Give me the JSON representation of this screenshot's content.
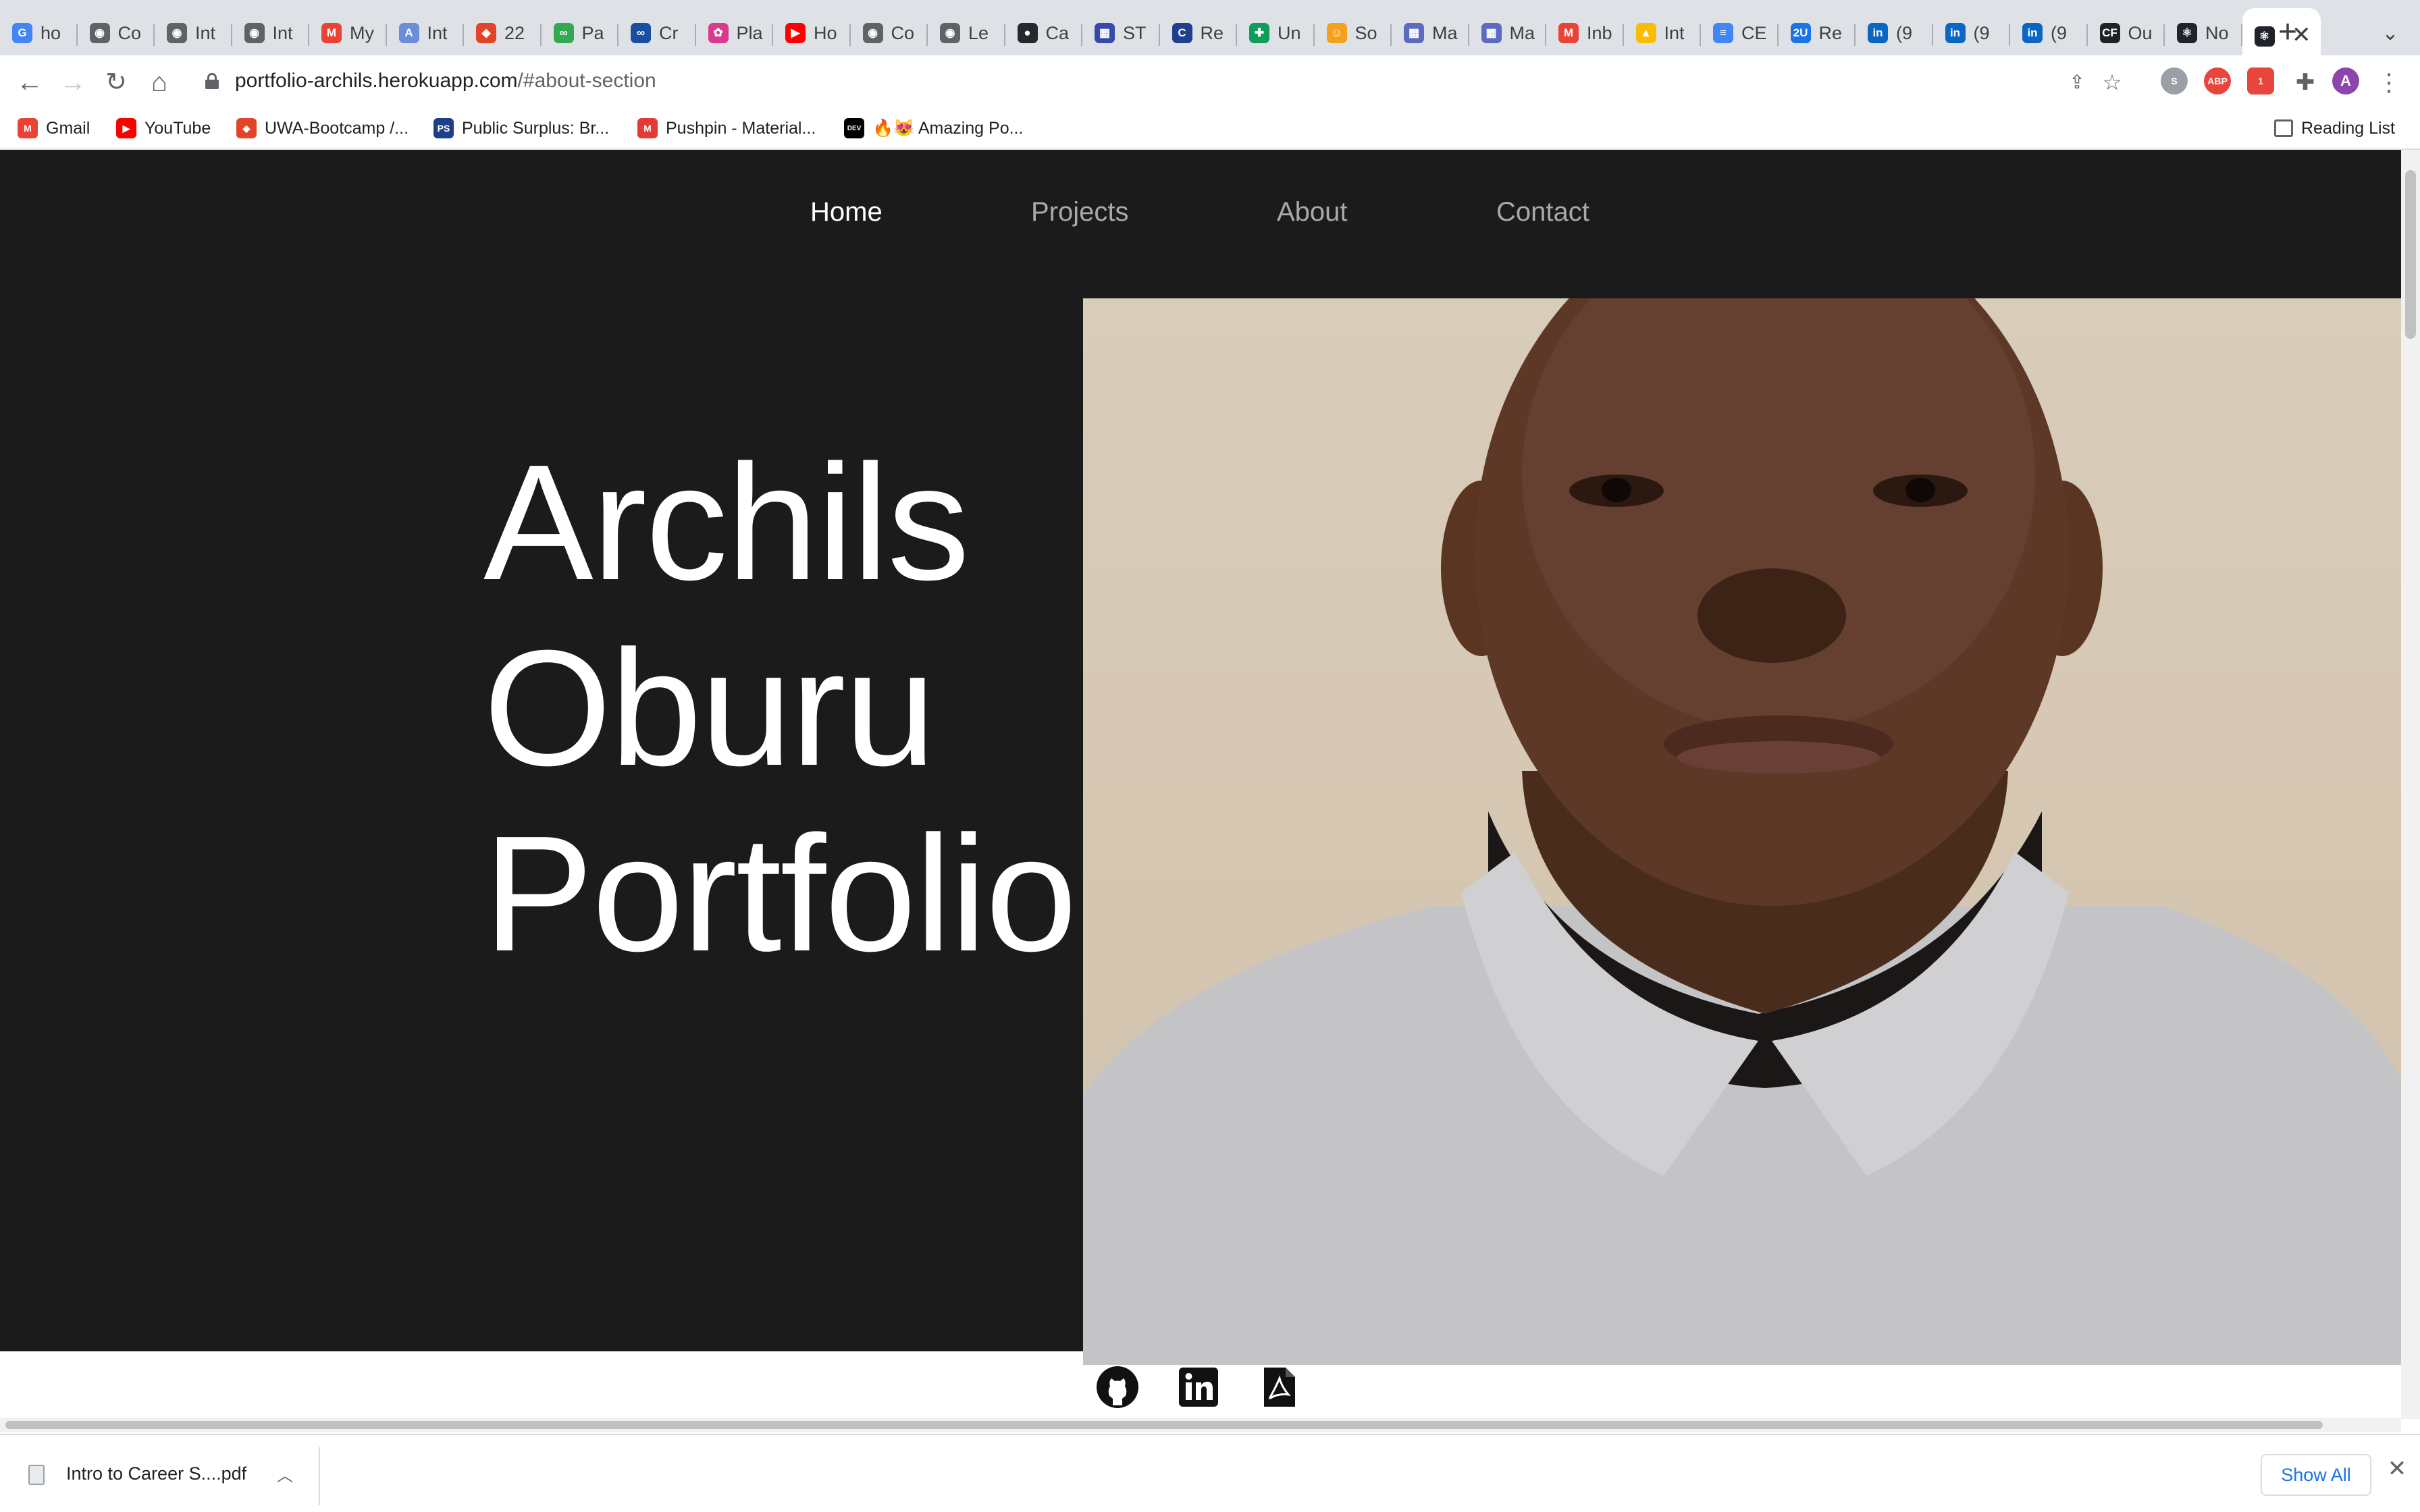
{
  "browser": {
    "tabs": [
      {
        "icon": "google-icon",
        "title": "ho",
        "color": "#4285f4",
        "glyph": "G"
      },
      {
        "icon": "globe-icon",
        "title": "Co",
        "color": "#5f6368",
        "glyph": "◉"
      },
      {
        "icon": "globe-icon",
        "title": "Int",
        "color": "#5f6368",
        "glyph": "◉"
      },
      {
        "icon": "globe-icon",
        "title": "Int",
        "color": "#5f6368",
        "glyph": "◉"
      },
      {
        "icon": "gmail-icon",
        "title": "My",
        "color": "#ea4335",
        "glyph": "M"
      },
      {
        "icon": "font-icon",
        "title": "Int",
        "color": "#6a8fd8",
        "glyph": "A"
      },
      {
        "icon": "gitlab-icon",
        "title": "22",
        "color": "#e24329",
        "glyph": "◆"
      },
      {
        "icon": "link-icon",
        "title": "Pa",
        "color": "#34a853",
        "glyph": "∞"
      },
      {
        "icon": "codepen-icon",
        "title": "Cr",
        "color": "#1a4fa0",
        "glyph": "∞"
      },
      {
        "icon": "flower-icon",
        "title": "Pla",
        "color": "#d93a8e",
        "glyph": "✿"
      },
      {
        "icon": "youtube-icon",
        "title": "Ho",
        "color": "#ff0000",
        "glyph": "▶"
      },
      {
        "icon": "globe-icon",
        "title": "Co",
        "color": "#5f6368",
        "glyph": "◉"
      },
      {
        "icon": "globe-icon",
        "title": "Le",
        "color": "#5f6368",
        "glyph": "◉"
      },
      {
        "icon": "github-icon",
        "title": "Ca",
        "color": "#24292e",
        "glyph": "●"
      },
      {
        "icon": "chart-icon",
        "title": "ST",
        "color": "#3949ab",
        "glyph": "▦"
      },
      {
        "icon": "cin-icon",
        "title": "Re",
        "color": "#1f3f8f",
        "glyph": "C"
      },
      {
        "icon": "sheets-icon",
        "title": "Un",
        "color": "#0f9d58",
        "glyph": "✚"
      },
      {
        "icon": "smile-icon",
        "title": "So",
        "color": "#f4a21d",
        "glyph": "☺"
      },
      {
        "icon": "grid-icon",
        "title": "Ma",
        "color": "#5c6bc0",
        "glyph": "▦"
      },
      {
        "icon": "grid-icon",
        "title": "Ma",
        "color": "#5c6bc0",
        "glyph": "▦"
      },
      {
        "icon": "gmail-icon",
        "title": "Inb",
        "color": "#ea4335",
        "glyph": "M"
      },
      {
        "icon": "drive-icon",
        "title": "Int",
        "color": "#fbbc04",
        "glyph": "▲"
      },
      {
        "icon": "docs-icon",
        "title": "CE",
        "color": "#4285f4",
        "glyph": "≡"
      },
      {
        "icon": "2u-icon",
        "title": "Re",
        "color": "#1a73e8",
        "glyph": "2U"
      },
      {
        "icon": "linkedin-icon",
        "title": "(9",
        "color": "#0a66c2",
        "glyph": "in"
      },
      {
        "icon": "linkedin-icon",
        "title": "(9",
        "color": "#0a66c2",
        "glyph": "in"
      },
      {
        "icon": "linkedin-icon",
        "title": "(9",
        "color": "#0a66c2",
        "glyph": "in"
      },
      {
        "icon": "cf-icon",
        "title": "Ou",
        "color": "#202124",
        "glyph": "CF"
      },
      {
        "icon": "react-icon",
        "title": "No",
        "color": "#20232a",
        "glyph": "⚛"
      },
      {
        "icon": "react-icon",
        "title": "",
        "color": "#20232a",
        "glyph": "⚛",
        "active": true
      }
    ],
    "tab_close": "✕",
    "new_tab": "+",
    "tab_search": "⌄",
    "url_host": "portfolio-archils.herokuapp.com",
    "url_path": "/#about-section",
    "profile_letter": "A",
    "bookmarks": [
      {
        "icon": "gmail-icon",
        "label": "Gmail",
        "color": "#ea4335",
        "glyph": "M"
      },
      {
        "icon": "youtube-icon",
        "label": "YouTube",
        "color": "#ff0000",
        "glyph": "▶"
      },
      {
        "icon": "gitlab-icon",
        "label": "UWA-Bootcamp /...",
        "color": "#e24329",
        "glyph": "◆"
      },
      {
        "icon": "publicsurplus-icon",
        "label": "Public Surplus: Br...",
        "color": "#1d3f8a",
        "glyph": "PS"
      },
      {
        "icon": "material-icon",
        "label": "Pushpin - Material...",
        "color": "#e53935",
        "glyph": "M"
      },
      {
        "icon": "dev-icon",
        "label": "🔥😻 Amazing Po...",
        "color": "#000000",
        "glyph": "DEV"
      }
    ],
    "reading_list": "Reading List"
  },
  "site": {
    "nav": [
      "Home",
      "Projects",
      "About",
      "Contact"
    ],
    "active_nav": "Home",
    "heading_lines": [
      "Archils",
      "Oburu",
      "Portfolio"
    ],
    "social_links": [
      "github-icon",
      "linkedin-icon",
      "pdf-icon"
    ]
  },
  "downloads": {
    "file": "Intro to Career S....pdf",
    "show_all": "Show All",
    "close": "✕"
  },
  "colors": {
    "hero_bg": "#1c1b1b",
    "nav_inactive": "#a9a9a9",
    "nav_active": "#ffffff",
    "link_blue": "#1a73e8"
  }
}
